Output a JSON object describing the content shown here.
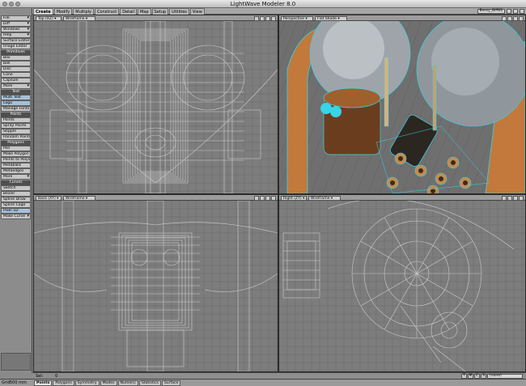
{
  "window": {
    "title": "LightWave Modeler 8.0"
  },
  "tabs": [
    "Create",
    "Modify",
    "Multiply",
    "Construct",
    "Detail",
    "Map",
    "Setup",
    "Utilities",
    "View"
  ],
  "layer_selector": "Bessy_BIPBS",
  "toolbar": {
    "top": [
      {
        "label": "File",
        "drop": true
      },
      {
        "label": "Diff",
        "drop": true
      },
      {
        "label": "Windows",
        "drop": true
      },
      {
        "label": "Help",
        "drop": true
      },
      {
        "label": "Surface Editor",
        "drop": false
      },
      {
        "label": "Image Editor",
        "drop": false
      }
    ],
    "groups": [
      {
        "title": "Primitives",
        "items": [
          {
            "label": "Box",
            "hl": false
          },
          {
            "label": "Ball",
            "hl": false
          },
          {
            "label": "Disc",
            "hl": false
          },
          {
            "label": "Cone",
            "hl": false
          },
          {
            "label": "Capsule",
            "hl": false
          },
          {
            "label": "More",
            "hl": false,
            "drop": true
          }
        ]
      },
      {
        "title": "Text",
        "items": [
          {
            "label": "Multi Text",
            "hl": true
          },
          {
            "label": "Logo",
            "hl": true
          },
          {
            "label": "Manage Fonts",
            "hl": false
          }
        ]
      },
      {
        "title": "Points",
        "items": [
          {
            "label": "Points",
            "hl": false
          },
          {
            "label": "Spray Points",
            "hl": false
          },
          {
            "label": "Stipple",
            "hl": false
          },
          {
            "label": "Random Points",
            "hl": false
          }
        ]
      },
      {
        "title": "Polygons",
        "items": [
          {
            "label": "Pen",
            "hl": false
          },
          {
            "label": "Make Polygon",
            "hl": false
          },
          {
            "label": "Points to Polys",
            "hl": false
          },
          {
            "label": "Metaballs",
            "hl": false
          },
          {
            "label": "Metaedges",
            "hl": false
          },
          {
            "label": "More",
            "hl": false,
            "drop": true
          }
        ]
      },
      {
        "title": "Curves",
        "items": [
          {
            "label": "Sketch",
            "hl": false
          },
          {
            "label": "Bezier",
            "hl": false
          },
          {
            "label": "Spline Draw",
            "hl": false
          },
          {
            "label": "Spline Cage",
            "hl": false
          },
          {
            "label": "Pixel 1D",
            "hl": true
          },
          {
            "label": "Make Curve",
            "hl": false,
            "drop": true
          }
        ]
      }
    ]
  },
  "viewports": {
    "top_left": {
      "view": "Top",
      "axis": "(XZ)",
      "mode": "Wireframe"
    },
    "top_right": {
      "view": "Perspective",
      "axis": "",
      "mode": "Flat Shade"
    },
    "bottom_left": {
      "view": "Back",
      "axis": "(XY)",
      "mode": "Wireframe"
    },
    "bottom_right": {
      "view": "Right",
      "axis": "(ZY)",
      "mode": "Wireframe"
    }
  },
  "numeric_bar": {
    "sel_label": "Sel:",
    "sel_count": "0",
    "buttons": [
      "T",
      "M",
      "C",
      "S"
    ],
    "layer_field": "(none)"
  },
  "status": {
    "grid_label": "Grid",
    "grid_value": "500 mm",
    "modes": [
      {
        "label": "Points",
        "active": true
      },
      {
        "label": "Polygons",
        "active": false
      },
      {
        "label": "Symmetry",
        "active": false
      },
      {
        "label": "Modes",
        "active": false
      },
      {
        "label": "Numeric",
        "active": false
      },
      {
        "label": "Statistics",
        "active": false
      },
      {
        "label": "Surface",
        "active": false
      }
    ]
  },
  "colors": {
    "viewport_bg": "#7d7d7d",
    "wire": "#dcdcdc",
    "grid": "#6b6b6b",
    "selection_cyan": "#39d4e6",
    "copper": "#c2793b"
  }
}
